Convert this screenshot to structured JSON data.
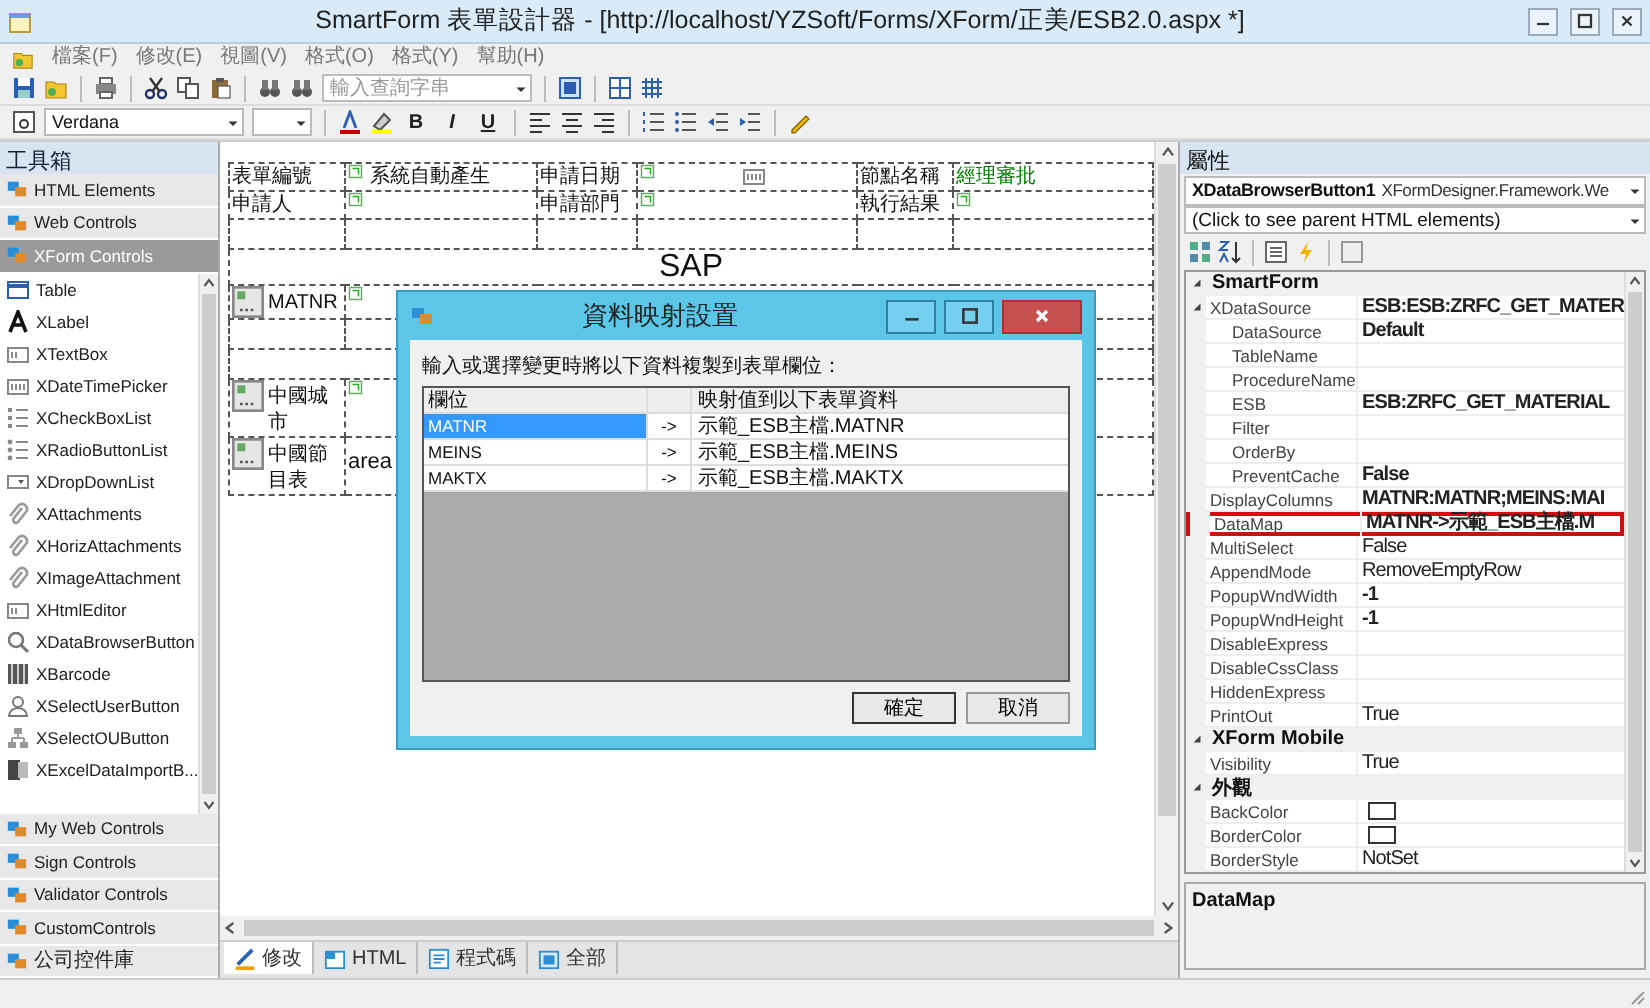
{
  "window": {
    "title": "SmartForm 表單設計器 - [http://localhost/YZSoft/Forms/XForm/正美/ESB2.0.aspx *]"
  },
  "menu": [
    {
      "label": "檔案(F)"
    },
    {
      "label": "修改(E)"
    },
    {
      "label": "視圖(V)"
    },
    {
      "label": "格式(O)"
    },
    {
      "label": "格式(Y)"
    },
    {
      "label": "幫助(H)"
    }
  ],
  "toolbar": {
    "search": {
      "placeholder": "輸入查詢字串"
    },
    "font": {
      "value": "Verdana"
    },
    "format_buttons": [
      {
        "label": "B"
      },
      {
        "label": "I"
      },
      {
        "label": "U"
      }
    ]
  },
  "toolbox": {
    "title": "工具箱",
    "groups_top": [
      {
        "label": "HTML Elements",
        "selected": false
      },
      {
        "label": "Web Controls",
        "selected": false
      },
      {
        "label": "XForm Controls",
        "selected": true
      }
    ],
    "items": [
      {
        "label": "Table"
      },
      {
        "label": "XLabel"
      },
      {
        "label": "XTextBox"
      },
      {
        "label": "XDateTimePicker"
      },
      {
        "label": "XCheckBoxList"
      },
      {
        "label": "XRadioButtonList"
      },
      {
        "label": "XDropDownList"
      },
      {
        "label": "XAttachments"
      },
      {
        "label": "XHorizAttachments"
      },
      {
        "label": "XImageAttachment"
      },
      {
        "label": "XHtmlEditor"
      },
      {
        "label": "XDataBrowserButton"
      },
      {
        "label": "XBarcode"
      },
      {
        "label": "XSelectUserButton"
      },
      {
        "label": "XSelectOUButton"
      },
      {
        "label": "XExcelDataImportB..."
      }
    ],
    "groups_bottom": [
      {
        "label": "My Web Controls",
        "selected": false
      },
      {
        "label": "Sign Controls",
        "selected": false
      },
      {
        "label": "Validator Controls",
        "selected": false
      },
      {
        "label": "CustomControls",
        "selected": false
      },
      {
        "label": "公司控件庫",
        "selected": false
      }
    ]
  },
  "designer": {
    "form_rows": [
      {
        "kind": "fields",
        "cells": [
          {
            "kind": "label",
            "text": "表單編號"
          },
          {
            "kind": "field",
            "text": "系統自動產生"
          },
          {
            "kind": "label",
            "text": "申請日期"
          },
          {
            "kind": "date"
          },
          {
            "kind": "label",
            "text": "節點名稱"
          },
          {
            "kind": "status",
            "text": "經理審批",
            "color": "#008000"
          }
        ]
      },
      {
        "kind": "fields",
        "cells": [
          {
            "kind": "label",
            "text": "申請人"
          },
          {
            "kind": "field"
          },
          {
            "kind": "label",
            "text": "申請部門"
          },
          {
            "kind": "field"
          },
          {
            "kind": "label",
            "text": "執行結果"
          },
          {
            "kind": "field"
          }
        ]
      },
      {
        "kind": "blank",
        "cells": [
          {
            "kind": "empty"
          },
          {
            "kind": "empty"
          },
          {
            "kind": "empty"
          },
          {
            "kind": "empty"
          },
          {
            "kind": "empty"
          },
          {
            "kind": "empty"
          }
        ]
      },
      {
        "kind": "heading",
        "cells": [
          {
            "kind": "heading",
            "text": "SAP",
            "colspan": 6
          }
        ]
      },
      {
        "kind": "fields",
        "cells": [
          {
            "kind": "button",
            "text": "MATNR"
          },
          {
            "kind": "field",
            "colspan": 5
          }
        ]
      },
      {
        "kind": "blank",
        "cells": [
          {
            "kind": "empty"
          },
          {
            "kind": "empty",
            "colspan": 5
          }
        ]
      },
      {
        "kind": "blank",
        "cells": [
          {
            "kind": "empty",
            "colspan": 6
          }
        ]
      },
      {
        "kind": "fields",
        "cells": [
          {
            "kind": "button",
            "text": "中國城市"
          },
          {
            "kind": "field",
            "colspan": 5
          }
        ]
      },
      {
        "kind": "fields",
        "cells": [
          {
            "kind": "button",
            "text": "中國節目表"
          },
          {
            "kind": "textarea",
            "text": "area",
            "colspan": 5
          }
        ]
      }
    ],
    "tabs": [
      {
        "label": "修改",
        "selected": true
      },
      {
        "label": "HTML",
        "selected": false
      },
      {
        "label": "程式碼",
        "selected": false
      },
      {
        "label": "全部",
        "selected": false
      }
    ]
  },
  "dialog": {
    "title": "資料映射設置",
    "instruction": "輸入或選擇變更時將以下資料複製到表單欄位：",
    "columns": [
      "欄位",
      "映射值到以下表單資料"
    ],
    "rows": [
      {
        "field": "MATNR",
        "arrow": "->",
        "target": "示範_ESB主檔.MATNR",
        "selected": true
      },
      {
        "field": "MEINS",
        "arrow": "->",
        "target": "示範_ESB主檔.MEINS",
        "selected": false
      },
      {
        "field": "MAKTX",
        "arrow": "->",
        "target": "示範_ESB主檔.MAKTX",
        "selected": false
      }
    ],
    "buttons": [
      "確定",
      "取消"
    ]
  },
  "properties": {
    "title": "屬性",
    "object_selector": {
      "name": "XDataBrowserButton1",
      "type": "XFormDesigner.Framework.We"
    },
    "parent_selector": "(Click to see parent HTML elements)",
    "rows": [
      {
        "kind": "category",
        "label": "SmartForm",
        "expanded": true,
        "children": [
          {
            "kind": "property",
            "name": "XDataSource",
            "value": "ESB:ESB:ZRFC_GET_MATER",
            "bold": true,
            "highlighted": false,
            "expanded": true,
            "children": [
              {
                "kind": "property",
                "name": "DataSource",
                "value": "Default",
                "bold": true,
                "highlighted": false
              },
              {
                "kind": "property",
                "name": "TableName",
                "highlighted": false
              },
              {
                "kind": "property",
                "name": "ProcedureName",
                "highlighted": false
              },
              {
                "kind": "property",
                "name": "ESB",
                "value": "ESB:ZRFC_GET_MATERIAL",
                "bold": true,
                "highlighted": false
              },
              {
                "kind": "property",
                "name": "Filter",
                "highlighted": false
              },
              {
                "kind": "property",
                "name": "OrderBy",
                "highlighted": false
              },
              {
                "kind": "property",
                "name": "PreventCache",
                "value": "False",
                "bold": true,
                "highlighted": false
              }
            ]
          },
          {
            "kind": "property",
            "name": "DisplayColumns",
            "value": "MATNR:MATNR;MEINS:MAI",
            "bold": true,
            "highlighted": false
          },
          {
            "kind": "property",
            "name": "DataMap",
            "value": "MATNR->示範_ESB主檔.M",
            "bold": true,
            "highlighted": true
          },
          {
            "kind": "property",
            "name": "MultiSelect",
            "value": "False",
            "bold": false,
            "highlighted": false
          },
          {
            "kind": "property",
            "name": "AppendMode",
            "value": "RemoveEmptyRow",
            "bold": false,
            "highlighted": false
          },
          {
            "kind": "property",
            "name": "PopupWndWidth",
            "value": "-1",
            "bold": true,
            "highlighted": false
          },
          {
            "kind": "property",
            "name": "PopupWndHeight",
            "value": "-1",
            "bold": true,
            "highlighted": false
          },
          {
            "kind": "property",
            "name": "DisableExpress",
            "highlighted": false
          },
          {
            "kind": "property",
            "name": "DisableCssClass",
            "highlighted": false
          },
          {
            "kind": "property",
            "name": "HiddenExpress",
            "highlighted": false
          },
          {
            "kind": "property",
            "name": "PrintOut",
            "value": "True",
            "bold": false,
            "highlighted": false
          }
        ]
      },
      {
        "kind": "category",
        "label": "XForm Mobile",
        "expanded": true,
        "children": [
          {
            "kind": "property",
            "name": "Visibility",
            "value": "True",
            "bold": false,
            "highlighted": false
          }
        ]
      },
      {
        "kind": "category",
        "label": "外觀",
        "expanded": true,
        "children": [
          {
            "kind": "color",
            "name": "BackColor",
            "highlighted": false
          },
          {
            "kind": "color",
            "name": "BorderColor",
            "highlighted": false
          },
          {
            "kind": "property",
            "name": "BorderStyle",
            "value": "NotSet",
            "bold": false,
            "highlighted": false
          }
        ]
      }
    ],
    "description_title": "DataMap"
  }
}
